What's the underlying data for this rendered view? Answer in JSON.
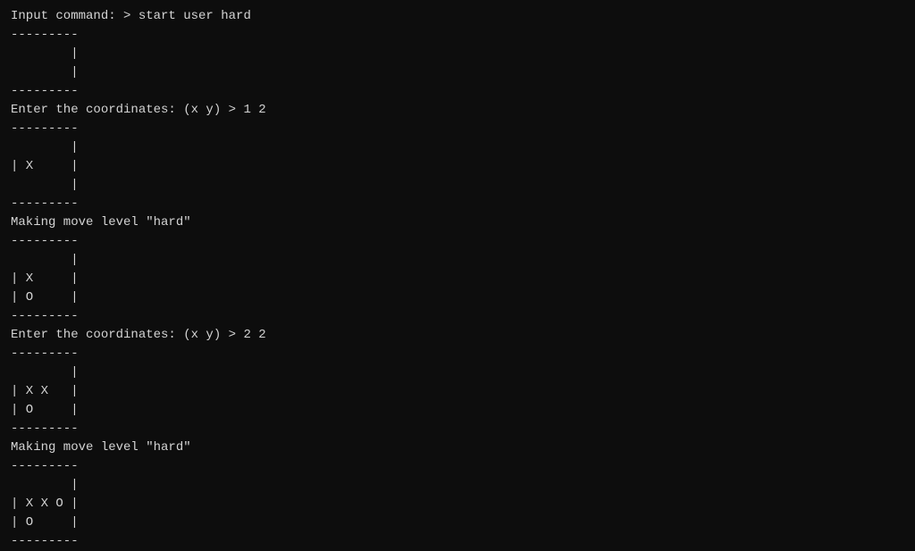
{
  "terminal": {
    "lines": [
      "Input command: > start user hard",
      "---------",
      "        |",
      "        |",
      "---------",
      "Enter the coordinates: (x y) > 1 2",
      "---------",
      "        |",
      "| X     |",
      "        |",
      "---------",
      "Making move level \"hard\"",
      "---------",
      "        |",
      "| X     |",
      "| O     |",
      "---------",
      "Enter the coordinates: (x y) > 2 2",
      "---------",
      "        |",
      "| X X   |",
      "| O     |",
      "---------",
      "Making move level \"hard\"",
      "---------",
      "        |",
      "| X X O |",
      "| O     |",
      "---------"
    ]
  }
}
